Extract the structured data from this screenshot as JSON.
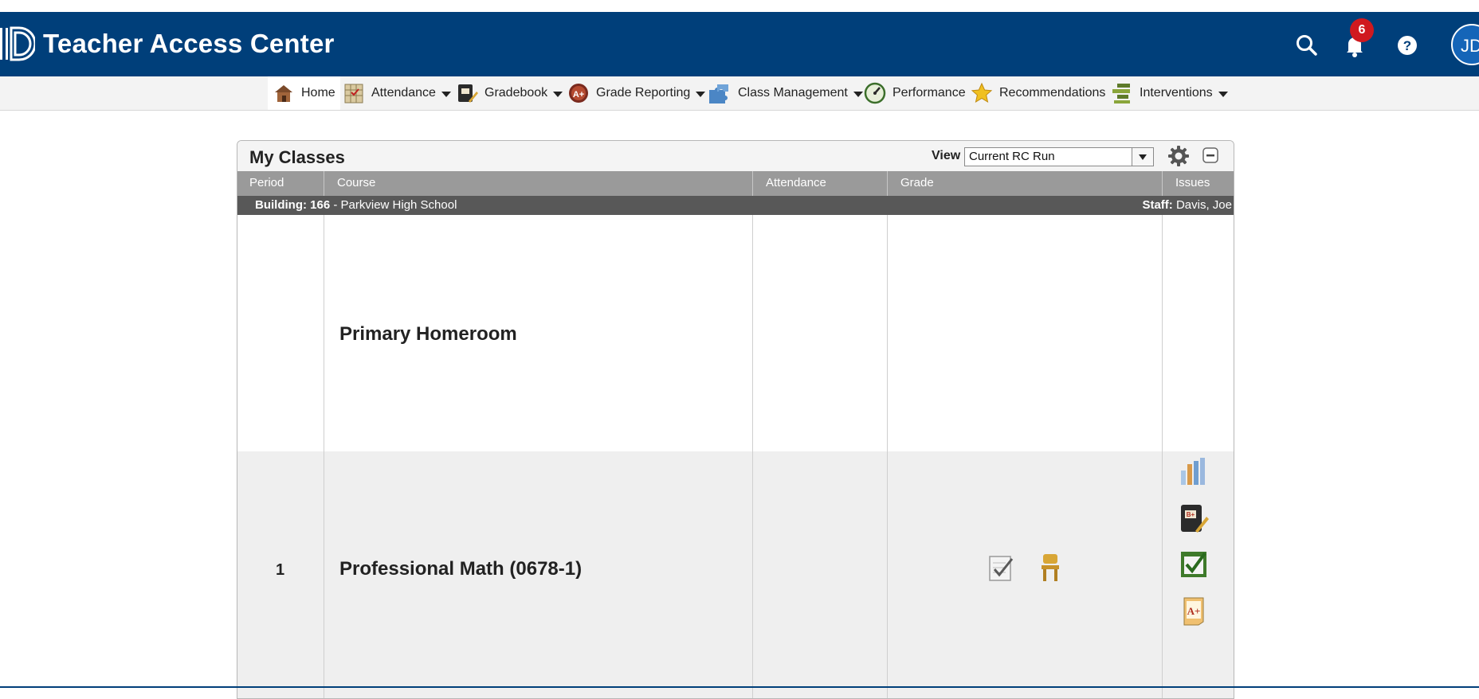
{
  "app": {
    "title": "Teacher Access Center"
  },
  "header": {
    "notification_count": "6",
    "user_initials": "JD",
    "colors": {
      "header_bg": "#003f7a",
      "badge": "#d0191f",
      "avatar": "#1565b8"
    }
  },
  "nav": {
    "items": [
      {
        "label": "Home",
        "icon": "home-icon",
        "dropdown": false
      },
      {
        "label": "Attendance",
        "icon": "attendance-icon",
        "dropdown": true
      },
      {
        "label": "Gradebook",
        "icon": "gradebook-icon",
        "dropdown": true
      },
      {
        "label": "Grade Reporting",
        "icon": "grade-reporting-icon",
        "dropdown": true
      },
      {
        "label": "Class Management",
        "icon": "puzzle-icon",
        "dropdown": true
      },
      {
        "label": "Performance",
        "icon": "speedometer-icon",
        "dropdown": false
      },
      {
        "label": "Recommendations",
        "icon": "star-icon",
        "dropdown": false
      },
      {
        "label": "Interventions",
        "icon": "interventions-icon",
        "dropdown": true
      }
    ]
  },
  "panel": {
    "title": "My Classes",
    "view_label": "View",
    "view_value": "Current RC Run",
    "columns": [
      "Period",
      "Course",
      "Attendance",
      "Grade",
      "Issues"
    ],
    "building_label": "Building: 166",
    "building_name": " - Parkview High School",
    "staff_label": "Staff:",
    "staff_name": " Davis, Joe",
    "rows": [
      {
        "period": "",
        "course": "Primary Homeroom",
        "grade_icons": [],
        "issue_icons": []
      },
      {
        "period": "1",
        "course": "Professional Math (0678-1)",
        "grade_icons": [
          "checklist-icon",
          "seating-chair-icon"
        ],
        "issue_icons": [
          "chart-bars-icon",
          "gradebook-icon",
          "attendance-check-icon",
          "grade-paper-icon"
        ]
      }
    ]
  }
}
